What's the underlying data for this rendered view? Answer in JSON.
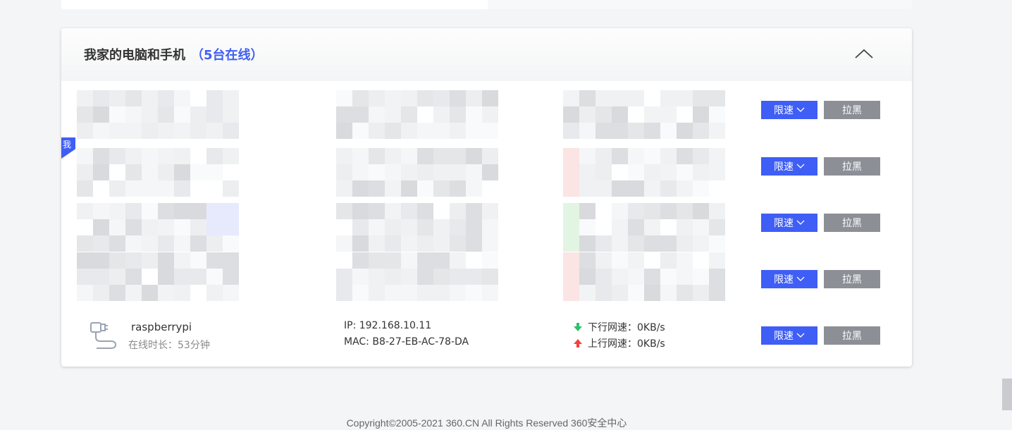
{
  "panel": {
    "title": "我家的电脑和手机",
    "online_count": "（5台在线）"
  },
  "me_tag": "我",
  "row_buttons": {
    "limit_label": "限速",
    "block_label": "拉黑"
  },
  "device": {
    "name": "raspberrypi",
    "online_time": "在线时长：53分钟",
    "ip": "IP: 192.168.10.11",
    "mac": "MAC: B8-27-EB-AC-78-DA",
    "download": "下行网速：0KB/s",
    "upload": "上行网速：0KB/s",
    "icon": "ethernet-cable-icon"
  },
  "colors": {
    "accent": "#3f5ef5",
    "block_button": "#8c8f96",
    "download_arrow": "#2dc26b",
    "upload_arrow": "#f5413c"
  },
  "footer": {
    "copyright": "Copyright©2005-2021 360.CN All Rights Reserved 360安全中心"
  }
}
